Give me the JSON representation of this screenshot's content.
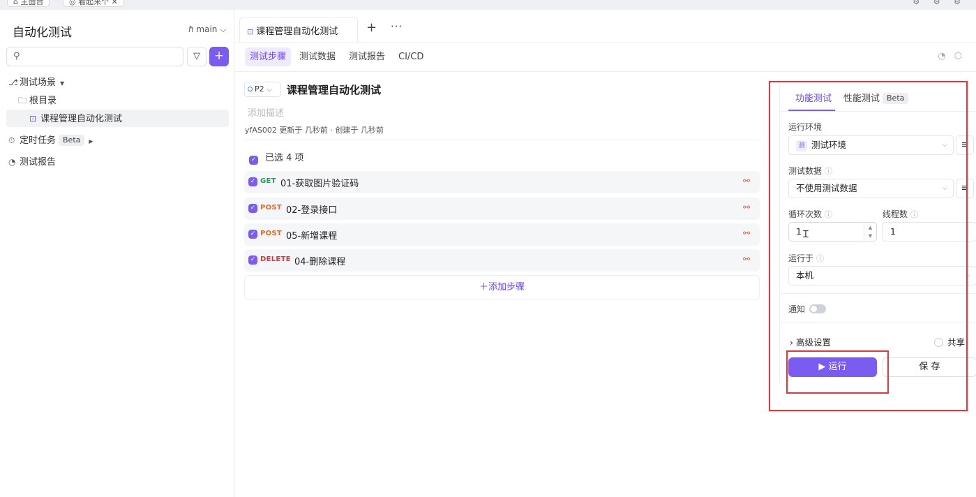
{
  "topbar": {
    "tab1": "⌂ 主面台",
    "tab2": "◎ 看起来个 ✕",
    "icons": "⚙ ⚙ ⚙"
  },
  "sidebar": {
    "title": "自动化测试",
    "branch": "ℏ main ⌵",
    "filter_icon": "▽",
    "add_icon": "+",
    "tree": {
      "scenes": "测试场景",
      "root": "根目录",
      "case": "课程管理自动化测试",
      "scheduled": "定时任务",
      "beta": "Beta",
      "reports": "测试报告"
    }
  },
  "main": {
    "doc_tab": "课程管理自动化测试",
    "tab_plus": "+",
    "tab_more": "···",
    "subtabs": [
      "测试步骤",
      "测试数据",
      "测试报告",
      "CI/CD"
    ],
    "priority": "P2",
    "case_title": "课程管理自动化测试",
    "desc_placeholder": "添加描述",
    "meta": "yfAS002 更新于 几秒前 · 创建于 几秒前",
    "selected": "已选 4 项",
    "steps": [
      {
        "method": "GET",
        "name": "01-获取图片验证码"
      },
      {
        "method": "POST",
        "name": "02-登录接口"
      },
      {
        "method": "POST",
        "name": "05-新增课程"
      },
      {
        "method": "DELETE",
        "name": "04-删除课程"
      }
    ],
    "add_step": "＋添加步骤"
  },
  "panel": {
    "tab_functional": "功能测试",
    "tab_performance": "性能测试",
    "beta": "Beta",
    "env_label": "运行环境",
    "env_icon": "测",
    "env_value": "测试环境",
    "data_label": "测试数据",
    "data_value": "不使用测试数据",
    "loop_label": "循环次数",
    "loop_value": "1",
    "thread_label": "线程数",
    "thread_value": "1",
    "run_on_label": "运行于",
    "run_on_value": "本机",
    "notify_label": "通知",
    "advanced": "高级设置",
    "share": "共享",
    "run_button": "▶ 运行",
    "save_button": "保 存"
  },
  "colors": {
    "accent": "#7b5cf0",
    "highlight": "#e6363b"
  }
}
